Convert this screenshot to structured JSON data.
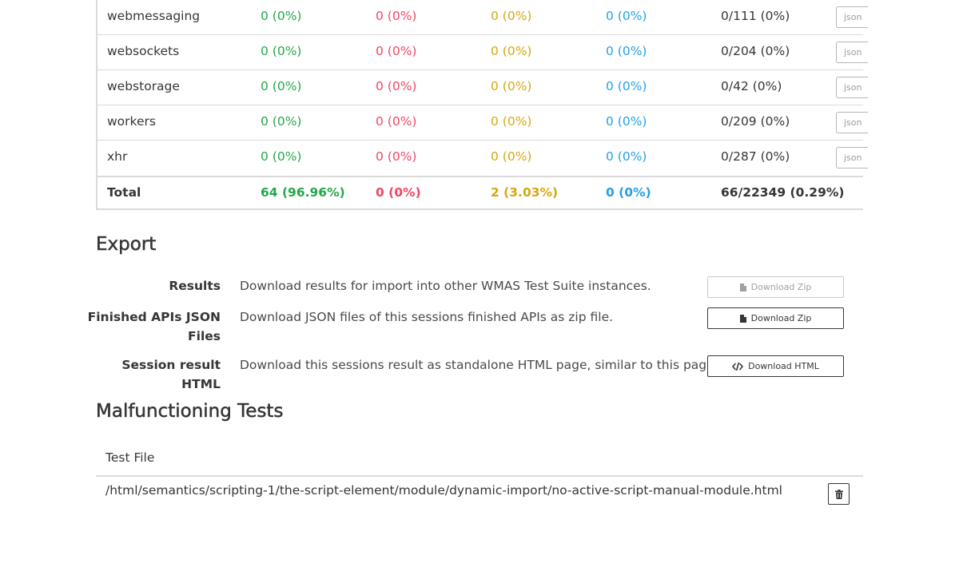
{
  "colors": {
    "pass": "#23a84a",
    "fail": "#f14668",
    "timeout": "#d6a811",
    "not_run": "#25a1e6"
  },
  "results_table": {
    "rows": [
      {
        "api": "webmessaging",
        "pass": "0 (0%)",
        "fail": "0 (0%)",
        "timeout": "0 (0%)",
        "not_run": "0 (0%)",
        "progress": "0/111 (0%)",
        "json_label": "json"
      },
      {
        "api": "websockets",
        "pass": "0 (0%)",
        "fail": "0 (0%)",
        "timeout": "0 (0%)",
        "not_run": "0 (0%)",
        "progress": "0/204 (0%)",
        "json_label": "json"
      },
      {
        "api": "webstorage",
        "pass": "0 (0%)",
        "fail": "0 (0%)",
        "timeout": "0 (0%)",
        "not_run": "0 (0%)",
        "progress": "0/42 (0%)",
        "json_label": "json"
      },
      {
        "api": "workers",
        "pass": "0 (0%)",
        "fail": "0 (0%)",
        "timeout": "0 (0%)",
        "not_run": "0 (0%)",
        "progress": "0/209 (0%)",
        "json_label": "json"
      },
      {
        "api": "xhr",
        "pass": "0 (0%)",
        "fail": "0 (0%)",
        "timeout": "0 (0%)",
        "not_run": "0 (0%)",
        "progress": "0/287 (0%)",
        "json_label": "json"
      }
    ],
    "total": {
      "label": "Total",
      "pass": "64 (96.96%)",
      "fail": "0 (0%)",
      "timeout": "2 (3.03%)",
      "not_run": "0 (0%)",
      "progress": "66/22349 (0.29%)"
    }
  },
  "export": {
    "title": "Export",
    "items": [
      {
        "label": "Results",
        "description": "Download results for import into other WMAS Test Suite instances.",
        "button_label": "Download Zip",
        "button_icon": "file-icon",
        "disabled": true
      },
      {
        "label": "Finished APIs JSON Files",
        "description": "Download JSON files of this sessions finished APIs as zip file.",
        "button_label": "Download Zip",
        "button_icon": "file-icon",
        "disabled": false
      },
      {
        "label": "Session result HTML",
        "description": "Download this sessions result as standalone HTML page, similar to this page.",
        "button_label": "Download HTML",
        "button_icon": "code-icon",
        "disabled": false
      }
    ]
  },
  "malfunctioning": {
    "title": "Malfunctioning Tests",
    "column_header": "Test File",
    "tests": [
      {
        "path": "/html/semantics/scripting-1/the-script-element/module/dynamic-import/no-active-script-manual-module.html",
        "action_icon": "trash-icon"
      }
    ]
  }
}
